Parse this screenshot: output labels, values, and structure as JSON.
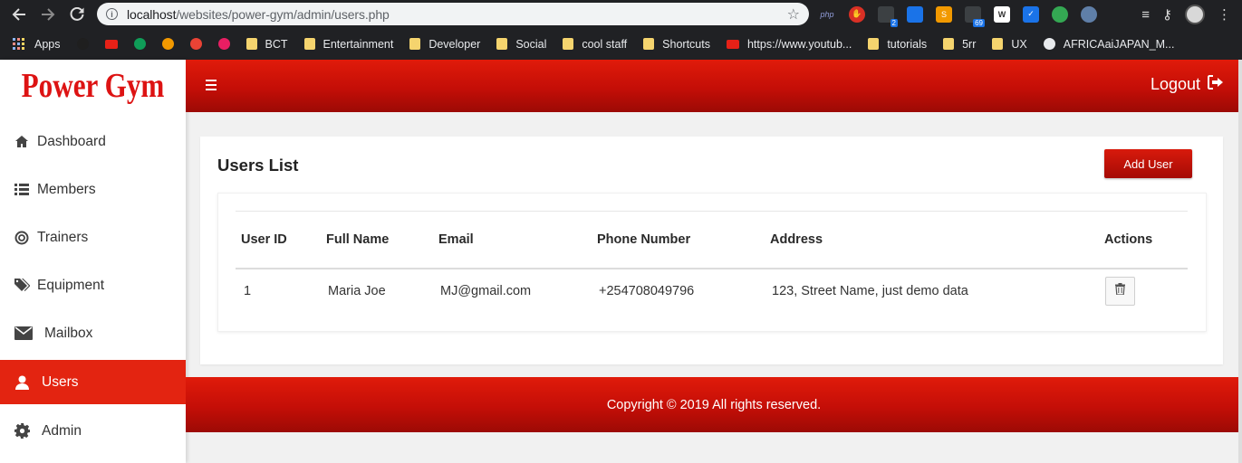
{
  "browser": {
    "url_host": "localhost",
    "url_path": "/websites/power-gym/admin/users.php",
    "bookmarks": [
      {
        "label": "Apps",
        "type": "apps"
      },
      {
        "label": "",
        "type": "ext"
      },
      {
        "label": "",
        "type": "yt"
      },
      {
        "label": "",
        "type": "ext"
      },
      {
        "label": "",
        "type": "ext"
      },
      {
        "label": "",
        "type": "ext"
      },
      {
        "label": "",
        "type": "ext"
      },
      {
        "label": "BCT",
        "type": "folder"
      },
      {
        "label": "Entertainment",
        "type": "folder"
      },
      {
        "label": "Developer",
        "type": "folder"
      },
      {
        "label": "Social",
        "type": "folder"
      },
      {
        "label": "cool staff",
        "type": "folder"
      },
      {
        "label": "Shortcuts",
        "type": "folder"
      },
      {
        "label": "https://www.youtub...",
        "type": "yt"
      },
      {
        "label": "tutorials",
        "type": "folder"
      },
      {
        "label": "5rr",
        "type": "folder"
      },
      {
        "label": "UX",
        "type": "folder"
      },
      {
        "label": "AFRICAaiJAPAN_M...",
        "type": "globe"
      }
    ],
    "ext_badges": {
      "first": "2",
      "second": "69"
    },
    "ext_php_label": "php"
  },
  "sidebar": {
    "brand": "Power Gym",
    "items": [
      {
        "label": "Dashboard",
        "icon": "home-icon",
        "active": false
      },
      {
        "label": "Members",
        "icon": "list-icon",
        "active": false
      },
      {
        "label": "Trainers",
        "icon": "lifebuoy-icon",
        "active": false
      },
      {
        "label": "Equipment",
        "icon": "tags-icon",
        "active": false
      },
      {
        "label": "Mailbox",
        "icon": "envelope-icon",
        "active": false
      },
      {
        "label": "Users",
        "icon": "user-icon",
        "active": true
      },
      {
        "label": "Admin",
        "icon": "gear-icon",
        "active": false
      }
    ]
  },
  "header": {
    "logout_label": "Logout"
  },
  "main": {
    "title": "Users List",
    "add_button": "Add User",
    "table": {
      "columns": [
        "User ID",
        "Full Name",
        "Email",
        "Phone Number",
        "Address",
        "Actions"
      ],
      "rows": [
        {
          "id": "1",
          "name": "Maria Joe",
          "email": "MJ@gmail.com",
          "phone": "+254708049796",
          "address": "123, Street Name, just demo data"
        }
      ]
    }
  },
  "footer": {
    "copyright": "Copyright © 2019 All rights reserved."
  },
  "colors": {
    "brand_red": "#dd1313",
    "header_red": "#c40e07",
    "active_item": "#e32411"
  }
}
